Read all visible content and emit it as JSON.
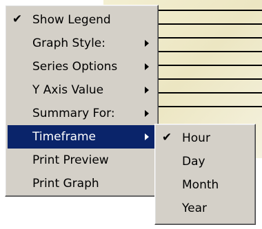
{
  "context_menu": {
    "items": [
      {
        "label": "Show Legend",
        "checked": true,
        "submenu": false
      },
      {
        "label": "Graph Style:",
        "checked": false,
        "submenu": true
      },
      {
        "label": "Series Options",
        "checked": false,
        "submenu": true
      },
      {
        "label": "Y Axis Value",
        "checked": false,
        "submenu": true
      },
      {
        "label": "Summary For:",
        "checked": false,
        "submenu": true
      },
      {
        "label": "Timeframe",
        "checked": false,
        "submenu": true,
        "highlighted": true
      },
      {
        "label": "Print Preview",
        "checked": false,
        "submenu": false
      },
      {
        "label": "Print Graph",
        "checked": false,
        "submenu": false
      }
    ]
  },
  "timeframe_submenu": {
    "items": [
      {
        "label": "Hour",
        "checked": true
      },
      {
        "label": "Day",
        "checked": false
      },
      {
        "label": "Month",
        "checked": false
      },
      {
        "label": "Year",
        "checked": false
      }
    ]
  },
  "icons": {
    "check": "✔"
  },
  "colors": {
    "menu_bg": "#d4d0c8",
    "highlight": "#0a246a"
  }
}
